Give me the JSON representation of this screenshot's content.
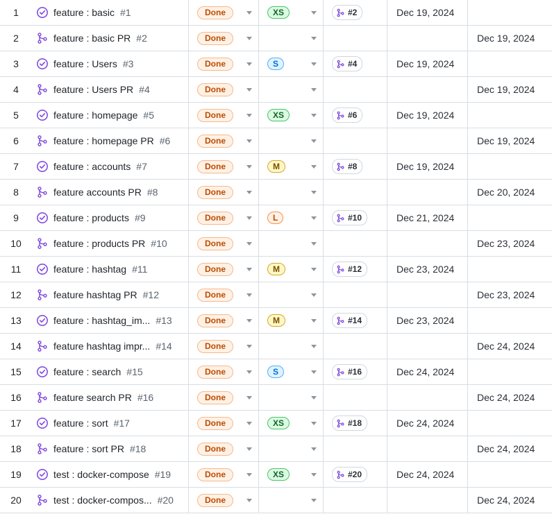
{
  "colors": {
    "status_done_bg": "#fff1e5",
    "status_done_border": "#f5b98c",
    "status_done_text": "#bc4c00",
    "issue_icon": "#8250df",
    "pr_icon": "#8250df",
    "size_xs": {
      "bg": "#dafbe1",
      "border": "#4ac26b",
      "text": "#116329"
    },
    "size_s": {
      "bg": "#ddf4ff",
      "border": "#54aeff",
      "text": "#0969da"
    },
    "size_m": {
      "bg": "#fff8c5",
      "border": "#d4a72c",
      "text": "#7d4e00"
    },
    "size_l": {
      "bg": "#fff1e5",
      "border": "#fb8f44",
      "text": "#bc4c00"
    }
  },
  "rows": [
    {
      "index": "1",
      "type_icon": "issue-closed-icon",
      "title": "feature : basic",
      "number": "#1",
      "status": "Done",
      "size": "XS",
      "linked_pr": "#2",
      "date_col1": "Dec 19, 2024",
      "date_col2": ""
    },
    {
      "index": "2",
      "type_icon": "pull-request-icon",
      "title": "feature : basic PR",
      "number": "#2",
      "status": "Done",
      "size": "",
      "linked_pr": "",
      "date_col1": "",
      "date_col2": "Dec 19, 2024"
    },
    {
      "index": "3",
      "type_icon": "issue-closed-icon",
      "title": "feature : Users",
      "number": "#3",
      "status": "Done",
      "size": "S",
      "linked_pr": "#4",
      "date_col1": "Dec 19, 2024",
      "date_col2": ""
    },
    {
      "index": "4",
      "type_icon": "pull-request-icon",
      "title": "feature : Users PR",
      "number": "#4",
      "status": "Done",
      "size": "",
      "linked_pr": "",
      "date_col1": "",
      "date_col2": "Dec 19, 2024"
    },
    {
      "index": "5",
      "type_icon": "issue-closed-icon",
      "title": "feature : homepage",
      "number": "#5",
      "status": "Done",
      "size": "XS",
      "linked_pr": "#6",
      "date_col1": "Dec 19, 2024",
      "date_col2": ""
    },
    {
      "index": "6",
      "type_icon": "pull-request-icon",
      "title": "feature : homepage PR",
      "number": "#6",
      "status": "Done",
      "size": "",
      "linked_pr": "",
      "date_col1": "",
      "date_col2": "Dec 19, 2024"
    },
    {
      "index": "7",
      "type_icon": "issue-closed-icon",
      "title": "feature : accounts",
      "number": "#7",
      "status": "Done",
      "size": "M",
      "linked_pr": "#8",
      "date_col1": "Dec 19, 2024",
      "date_col2": ""
    },
    {
      "index": "8",
      "type_icon": "pull-request-icon",
      "title": "feature accounts PR",
      "number": "#8",
      "status": "Done",
      "size": "",
      "linked_pr": "",
      "date_col1": "",
      "date_col2": "Dec 20, 2024"
    },
    {
      "index": "9",
      "type_icon": "issue-closed-icon",
      "title": "feature : products",
      "number": "#9",
      "status": "Done",
      "size": "L",
      "linked_pr": "#10",
      "date_col1": "Dec 21, 2024",
      "date_col2": ""
    },
    {
      "index": "10",
      "type_icon": "pull-request-icon",
      "title": "feature : products PR",
      "number": "#10",
      "status": "Done",
      "size": "",
      "linked_pr": "",
      "date_col1": "",
      "date_col2": "Dec 23, 2024"
    },
    {
      "index": "11",
      "type_icon": "issue-closed-icon",
      "title": "feature : hashtag",
      "number": "#11",
      "status": "Done",
      "size": "M",
      "linked_pr": "#12",
      "date_col1": "Dec 23, 2024",
      "date_col2": ""
    },
    {
      "index": "12",
      "type_icon": "pull-request-icon",
      "title": "feature hashtag PR",
      "number": "#12",
      "status": "Done",
      "size": "",
      "linked_pr": "",
      "date_col1": "",
      "date_col2": "Dec 23, 2024"
    },
    {
      "index": "13",
      "type_icon": "issue-closed-icon",
      "title": "feature : hashtag_im...",
      "number": "#13",
      "status": "Done",
      "size": "M",
      "linked_pr": "#14",
      "date_col1": "Dec 23, 2024",
      "date_col2": ""
    },
    {
      "index": "14",
      "type_icon": "pull-request-icon",
      "title": "feature hashtag impr...",
      "number": "#14",
      "status": "Done",
      "size": "",
      "linked_pr": "",
      "date_col1": "",
      "date_col2": "Dec 24, 2024"
    },
    {
      "index": "15",
      "type_icon": "issue-closed-icon",
      "title": "feature : search",
      "number": "#15",
      "status": "Done",
      "size": "S",
      "linked_pr": "#16",
      "date_col1": "Dec 24, 2024",
      "date_col2": ""
    },
    {
      "index": "16",
      "type_icon": "pull-request-icon",
      "title": "feature search PR",
      "number": "#16",
      "status": "Done",
      "size": "",
      "linked_pr": "",
      "date_col1": "",
      "date_col2": "Dec 24, 2024"
    },
    {
      "index": "17",
      "type_icon": "issue-closed-icon",
      "title": "feature : sort",
      "number": "#17",
      "status": "Done",
      "size": "XS",
      "linked_pr": "#18",
      "date_col1": "Dec 24, 2024",
      "date_col2": ""
    },
    {
      "index": "18",
      "type_icon": "pull-request-icon",
      "title": "feature : sort PR",
      "number": "#18",
      "status": "Done",
      "size": "",
      "linked_pr": "",
      "date_col1": "",
      "date_col2": "Dec 24, 2024"
    },
    {
      "index": "19",
      "type_icon": "issue-closed-icon",
      "title": "test : docker-compose",
      "number": "#19",
      "status": "Done",
      "size": "XS",
      "linked_pr": "#20",
      "date_col1": "Dec 24, 2024",
      "date_col2": ""
    },
    {
      "index": "20",
      "type_icon": "pull-request-icon",
      "title": "test : docker-compos...",
      "number": "#20",
      "status": "Done",
      "size": "",
      "linked_pr": "",
      "date_col1": "",
      "date_col2": "Dec 24, 2024"
    }
  ]
}
